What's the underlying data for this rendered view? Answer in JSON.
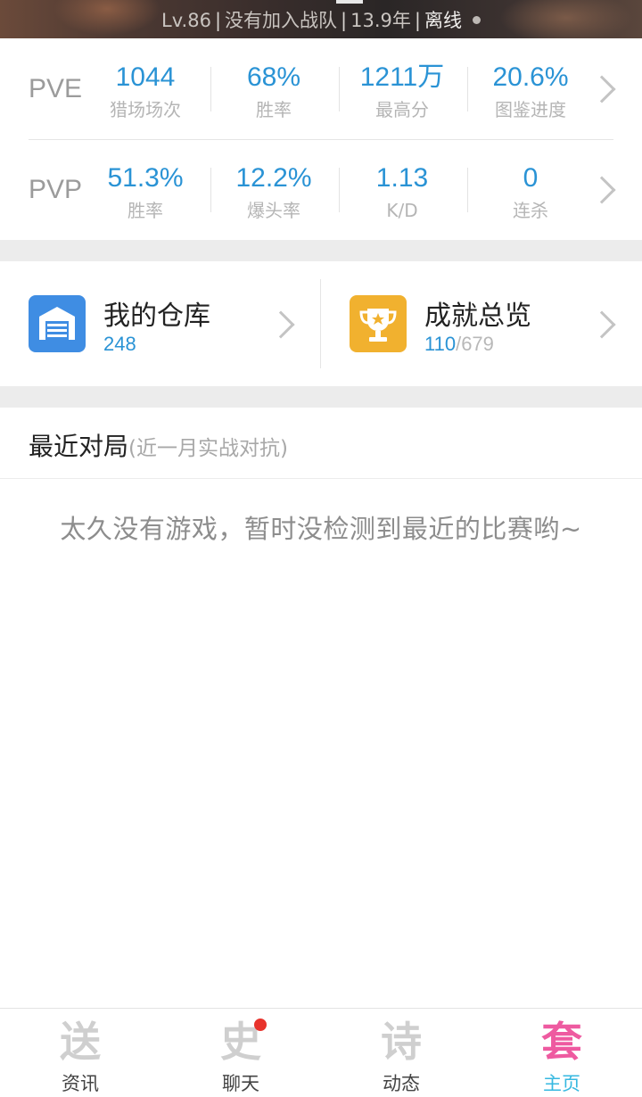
{
  "header": {
    "level": "Lv.86",
    "team": "没有加入战队",
    "years": "13.9年",
    "status": "离线"
  },
  "pve": {
    "label": "PVE",
    "stats": [
      {
        "value": "1044",
        "label": "猎场场次"
      },
      {
        "value": "68%",
        "label": "胜率"
      },
      {
        "value": "1211万",
        "label": "最高分"
      },
      {
        "value": "20.6%",
        "label": "图鉴进度"
      }
    ]
  },
  "pvp": {
    "label": "PVP",
    "stats": [
      {
        "value": "51.3%",
        "label": "胜率"
      },
      {
        "value": "12.2%",
        "label": "爆头率"
      },
      {
        "value": "1.13",
        "label": "K/D"
      },
      {
        "value": "0",
        "label": "连杀"
      }
    ]
  },
  "shortcuts": {
    "warehouse": {
      "title": "我的仓库",
      "count": "248"
    },
    "achievements": {
      "title": "成就总览",
      "done": "110",
      "total": "/679"
    }
  },
  "recent": {
    "title": "最近对局",
    "subtitle": "(近一月实战对抗)",
    "empty_message": "太久没有游戏，暂时没检测到最近的比赛哟~"
  },
  "nav": {
    "items": [
      {
        "label": "资讯",
        "glyph": "送",
        "icon": "news-icon"
      },
      {
        "label": "聊天",
        "glyph": "史",
        "icon": "chat-icon"
      },
      {
        "label": "动态",
        "glyph": "诗",
        "icon": "feed-icon"
      },
      {
        "label": "主页",
        "glyph": "套",
        "icon": "home-icon"
      }
    ],
    "active_index": 3
  },
  "colors": {
    "accent_blue": "#2a93d5",
    "active_tab_label": "#36b8e0",
    "active_tab_icon": "#ee5aa0",
    "warehouse_icon_bg": "#3f8de3",
    "achievement_icon_bg": "#f1b12f",
    "notification_badge": "#e8332c"
  }
}
